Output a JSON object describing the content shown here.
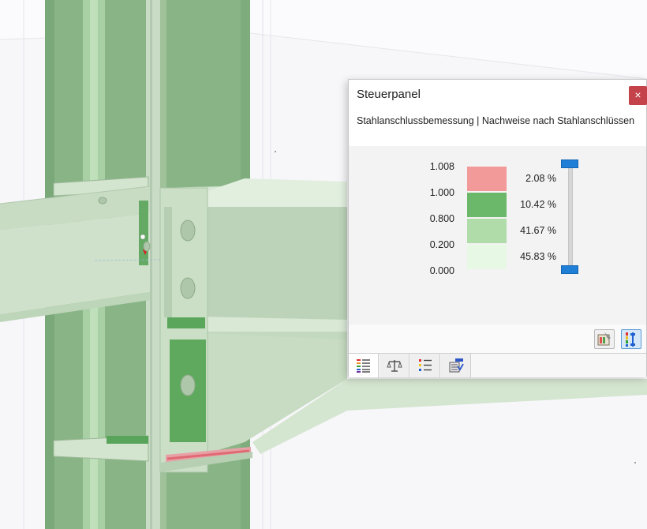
{
  "panel": {
    "title": "Steuerpanel",
    "close_glyph": "×",
    "subtitle": "Stahlanschlussbemessung | Nachweise nach Stahlanschlüssen",
    "scale_labels": [
      "1.008",
      "1.000",
      "0.800",
      "0.200",
      "0.000"
    ],
    "legend": [
      {
        "percent": "2.08 %",
        "color": "#f29a9a"
      },
      {
        "percent": "10.42 %",
        "color": "#6cb86a"
      },
      {
        "percent": "41.67 %",
        "color": "#b0dcaa"
      },
      {
        "percent": "45.83 %",
        "color": "#e7f8e4"
      }
    ],
    "tool_buttons": [
      "color-scale-settings-icon",
      "color-spectrum-icon"
    ],
    "tabs": [
      {
        "icon": "color-legend-icon",
        "active": true
      },
      {
        "icon": "balance-scale-icon",
        "active": false
      },
      {
        "icon": "list-icon",
        "active": false
      },
      {
        "icon": "design-check-icon",
        "active": false
      }
    ]
  },
  "colors": {
    "steel_green": "#8db58a",
    "steel_light": "#c6dcc2",
    "failure_red": "#e06a74",
    "accent_blue": "#1f7fd6"
  }
}
